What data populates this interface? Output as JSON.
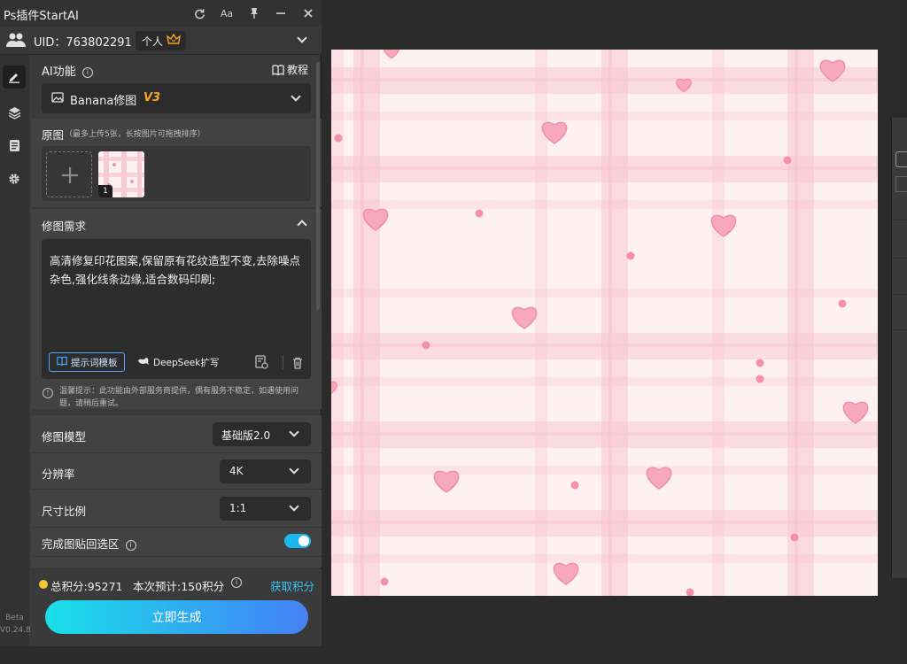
{
  "titlebar": {
    "title": "Ps插件StartAI",
    "icons": [
      "refresh-icon",
      "font-size-icon",
      "pin-icon",
      "minimize-icon",
      "close-icon"
    ],
    "font_size_label": "Aa"
  },
  "account": {
    "uid_label": "UID：763802291",
    "plan_badge": "个人",
    "plan_icon": "crown-icon"
  },
  "rail": {
    "items": [
      "edit-icon",
      "layers-icon",
      "notes-icon",
      "settings-icon"
    ],
    "beta_label": "Beta",
    "version": "V0.24.8"
  },
  "ai_function": {
    "label": "AI功能",
    "tutorial_label": "教程",
    "selected": "Banana修图",
    "version_tag": "V3"
  },
  "original": {
    "label": "原图",
    "hint": "（最多上传5张，长按图片可拖拽排序）",
    "thumb_index": "1"
  },
  "requirement": {
    "label": "修图需求",
    "text": "高清修复印花图案,保留原有花纹造型不变,去除噪点杂色,强化线条边缘,适合数码印刷;",
    "template_button": "提示词模板",
    "deepseek_button": "DeepSeek扩写",
    "warning": "温馨提示：此功能由外部服务商提供，偶有服务不稳定，如遇使用问题，请稍后重试。"
  },
  "settings": {
    "model_label": "修图模型",
    "model_value": "基础版2.0",
    "resolution_label": "分辨率",
    "resolution_value": "4K",
    "ratio_label": "尺寸比例",
    "ratio_value": "1:1",
    "paste_back_label": "完成图贴回选区",
    "paste_back_enabled": true
  },
  "footer": {
    "total_points": "总积分:95271",
    "estimate": "本次预计:150积分",
    "get_points": "获取积分",
    "generate_button": "立即生成"
  },
  "colors": {
    "accent": "#19b8f0",
    "version_tag": "#f5a623",
    "link": "#33c8f5",
    "heart": "#f7a8bf",
    "plaid": "#f8c4d2",
    "canvas_bg": "#fdf1f1"
  }
}
